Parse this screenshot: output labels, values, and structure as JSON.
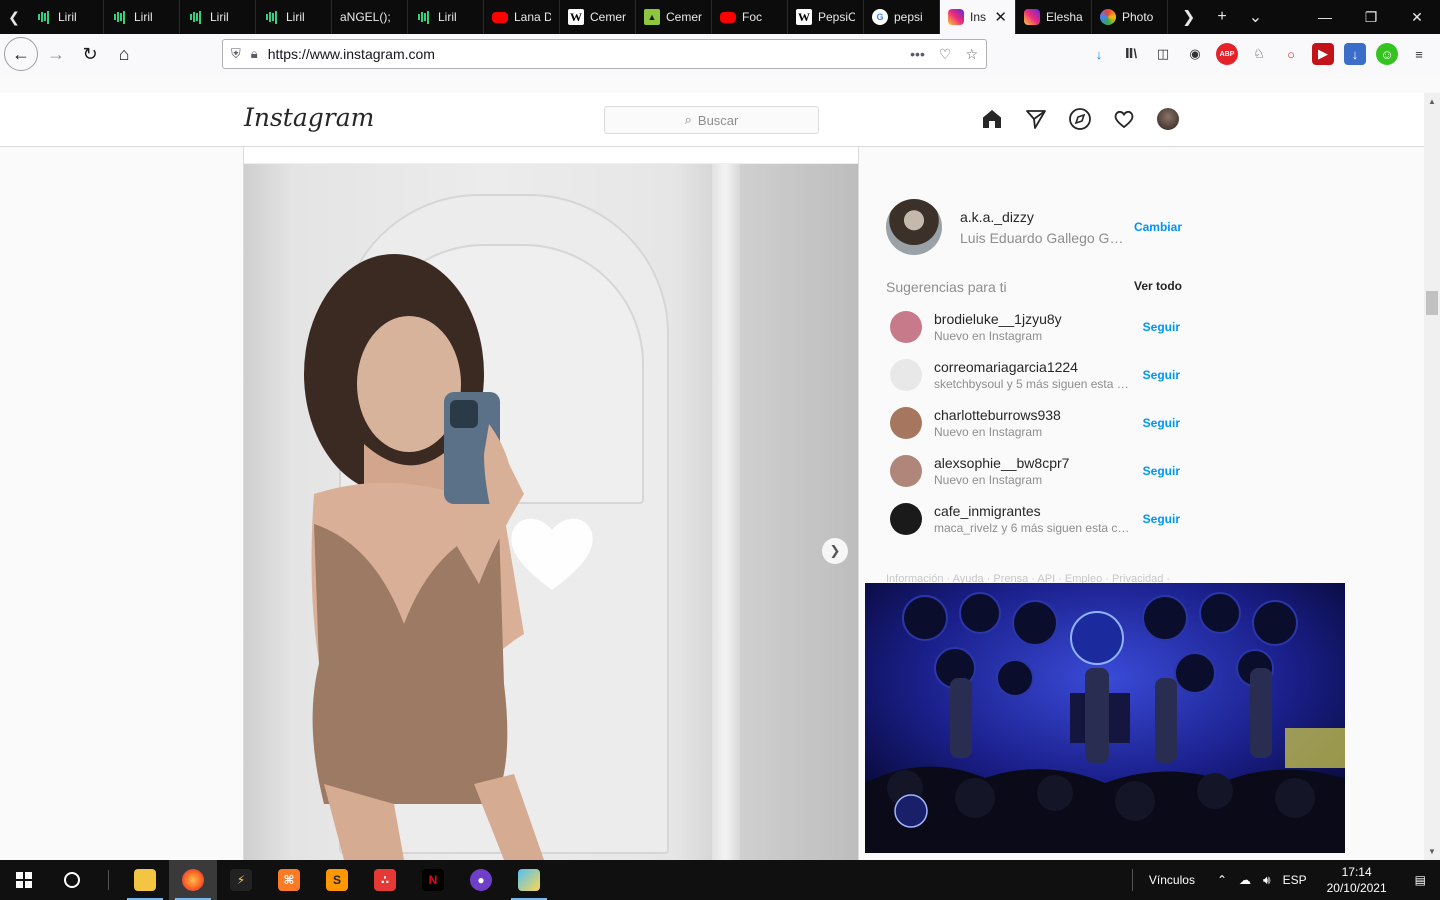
{
  "browser": {
    "tabs": [
      {
        "label": "Liril",
        "icon": "liril-icon"
      },
      {
        "label": "Liril",
        "icon": "liril-icon"
      },
      {
        "label": "Liril",
        "icon": "liril-icon"
      },
      {
        "label": "Liril",
        "icon": "liril-icon"
      },
      {
        "label": "aNGEL();",
        "icon": ""
      },
      {
        "label": "Liril",
        "icon": "liril-icon"
      },
      {
        "label": "Lana D",
        "icon": "youtube-icon"
      },
      {
        "label": "Cemer",
        "icon": "wikipedia-icon"
      },
      {
        "label": "Cemer",
        "icon": "cemento-icon"
      },
      {
        "label": "Foc",
        "icon": "youtube-icon"
      },
      {
        "label": "PepsiC",
        "icon": "wikipedia-icon"
      },
      {
        "label": "pepsi",
        "icon": "google-icon"
      },
      {
        "label": "Ins",
        "icon": "instagram-icon",
        "active": true
      },
      {
        "label": "Elesha",
        "icon": "instagram-icon"
      },
      {
        "label": "Photo",
        "icon": "google-photos-icon"
      }
    ],
    "url": "https://www.instagram.com",
    "colors": {
      "accent_download": "#0a84ff",
      "tab_bar": "#0c0c0d"
    }
  },
  "instagram": {
    "logo_text": "Instagram",
    "search_placeholder": "Buscar",
    "profile": {
      "username": "a.k.a._dizzy",
      "full_name": "Luis Eduardo Gallego Gar...",
      "switch_label": "Cambiar"
    },
    "suggestions_title": "Sugerencias para ti",
    "see_all_label": "Ver todo",
    "suggestions": [
      {
        "username": "brodieluke__1jzyu8y",
        "desc": "Nuevo en Instagram",
        "action": "Seguir",
        "color": "#c77b8a"
      },
      {
        "username": "correomariagarcia1224",
        "desc": "sketchbysoul y 5 más siguen esta cu...",
        "action": "Seguir",
        "color": "#e8e8e8"
      },
      {
        "username": "charlotteburrows938",
        "desc": "Nuevo en Instagram",
        "action": "Seguir",
        "color": "#a6765e"
      },
      {
        "username": "alexsophie__bw8cpr7",
        "desc": "Nuevo en Instagram",
        "action": "Seguir",
        "color": "#b0857a"
      },
      {
        "username": "cafe_inmigrantes",
        "desc": "maca_rivelz y 6 más siguen esta cue...",
        "action": "Seguir",
        "color": "#1a1a1a"
      }
    ],
    "footer_links": "Información · Ayuda · Prensa · API · Empleo · Privacidad ·",
    "colors": {
      "link_blue": "#0095f6",
      "secondary_text": "#8e8e8e"
    }
  },
  "taskbar": {
    "tray_label": "Vínculos",
    "language": "ESP",
    "time": "17:14",
    "date": "20/10/2021"
  }
}
